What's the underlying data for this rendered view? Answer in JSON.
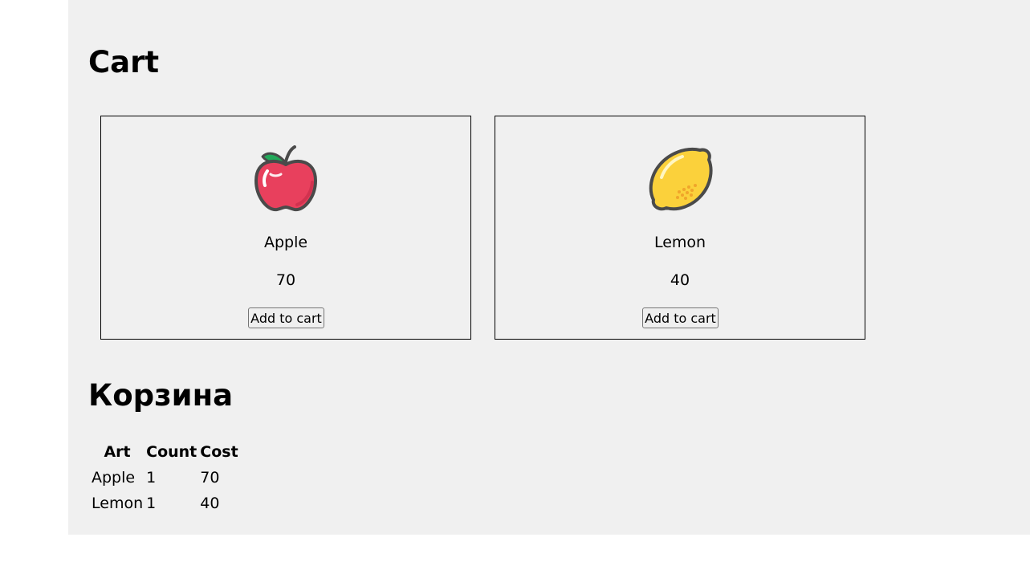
{
  "page": {
    "title": "Cart",
    "cart_title": "Корзина"
  },
  "products": [
    {
      "name": "Apple",
      "price": "70",
      "button_label": "Add to cart",
      "icon": "apple-icon"
    },
    {
      "name": "Lemon",
      "price": "40",
      "button_label": "Add to cart",
      "icon": "lemon-icon"
    }
  ],
  "cart_table": {
    "headers": [
      "Art",
      "Count",
      "Cost"
    ],
    "rows": [
      [
        "Apple",
        "1",
        "70"
      ],
      [
        "Lemon",
        "1",
        "40"
      ]
    ]
  },
  "colors": {
    "background": "#f0f0f0",
    "apple_red": "#e8405d",
    "leaf_green": "#23a95a",
    "lemon_yellow": "#fbd13b",
    "outline": "#4a4a4a"
  }
}
